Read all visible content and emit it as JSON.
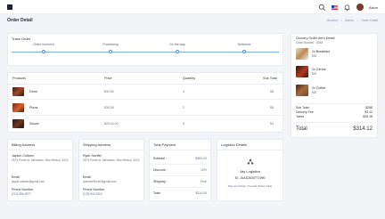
{
  "header": {
    "user_name": "Alson",
    "page_title": "Order Detail",
    "breadcrumb": [
      "Grocery",
      "Admin",
      "Order Detail"
    ],
    "breadcrumb_sep": ">"
  },
  "track": {
    "title": "Track Order",
    "steps": [
      "Order received",
      "Processing",
      "On the way",
      "Delivered"
    ]
  },
  "products": {
    "headers": [
      "Products",
      "Price",
      "Quantity",
      "Sub Total"
    ],
    "rows": [
      {
        "name": "Drink",
        "price": "$34.50",
        "qty": "4",
        "subtotal": "$8"
      },
      {
        "name": "Pizza",
        "price": "$30.00",
        "qty": "2",
        "subtotal": "$6"
      },
      {
        "name": "Sauce",
        "price": "$23.44.00",
        "qty": "5",
        "subtotal": "$3"
      }
    ]
  },
  "billing": {
    "title": "Billing Address",
    "name": "Jayson Colbam",
    "address": "2673 Porter st, Allentown, New Mexico, 4416",
    "email_label": "Email",
    "email": "jaycal.colbam@gmail.com",
    "phone_label": "Phone Number",
    "phone": "(213) 555-5977"
  },
  "shipping": {
    "title": "Shipping Address",
    "name": "Ryan Seelfer",
    "address": "2673 Porter st, Allentown, New Mexico, 4416",
    "email_label": "Email",
    "email": "ryanseelfer.art@gmail.com",
    "phone_label": "Phone Number",
    "phone": "(123) 543-9110"
  },
  "payment": {
    "title": "Total Payment",
    "rows": [
      {
        "label": "Subtotal :",
        "value": "$362.00"
      },
      {
        "label": "Discount :",
        "value": "15%"
      },
      {
        "label": "Shipping :",
        "value": "Free"
      },
      {
        "label": "Total :",
        "value": "$314.00"
      }
    ]
  },
  "logistics": {
    "title": "Logistics Details",
    "company": "Jay Logistics",
    "id": "ID: JUAS2634771990",
    "payment_mode": "Payment Mode: Prepaid (Debit Card)"
  },
  "summary": {
    "title": "Grocery Order Item Detail",
    "order_number": "Order Number : 3064",
    "items": [
      {
        "name": "2x Breakfast",
        "price": "$30"
      },
      {
        "name": "2x Cereal",
        "price": "$52"
      },
      {
        "name": "2x Coffee",
        "price": "$30"
      }
    ],
    "subtotal_label": "Sub Total",
    "subtotal": "$288",
    "delivery_label": "Delivery Fee",
    "delivery": "$3.12",
    "taxes_label": "Taxes",
    "taxes": "$25.18",
    "total_label": "Total",
    "total": "$314.12"
  }
}
